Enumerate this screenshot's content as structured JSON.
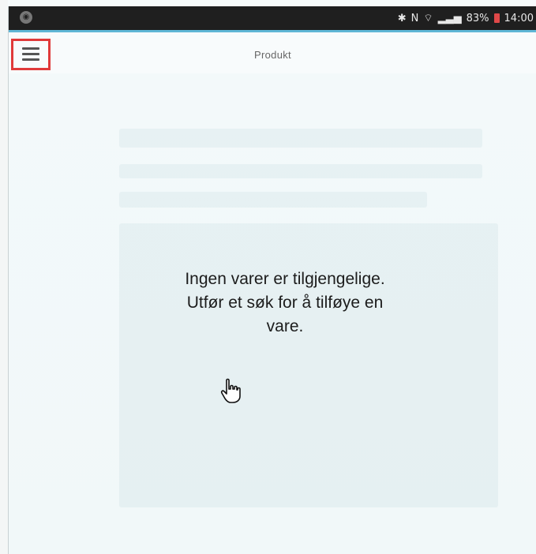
{
  "status_bar": {
    "battery": "83%",
    "time": "14:00"
  },
  "header": {
    "title": "Produkt"
  },
  "main": {
    "empty_message": "Ingen varer er tilgjengelige. Utfør et søk for å tilføye en vare."
  },
  "colors": {
    "highlight": "#e03a3a",
    "accent": "#5fb6d6"
  }
}
